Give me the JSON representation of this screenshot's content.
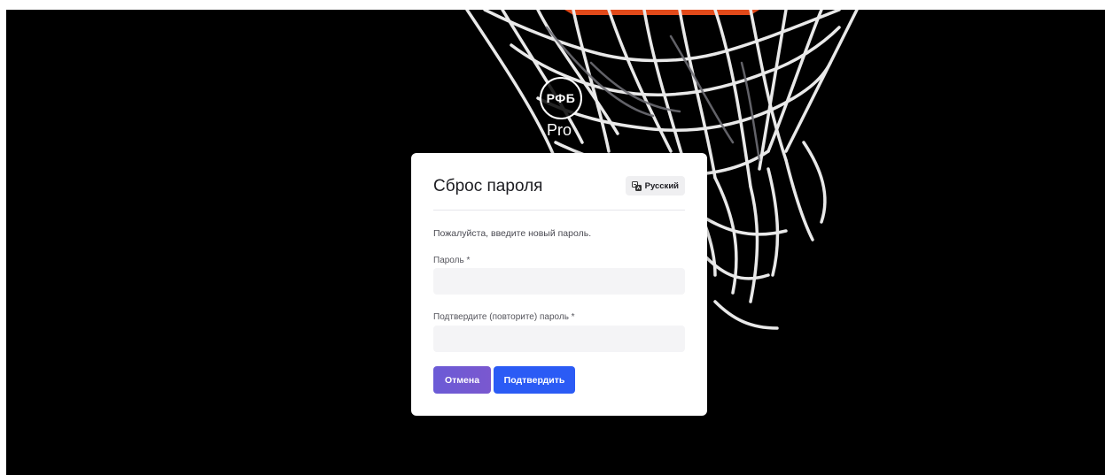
{
  "brand": {
    "logo_text": "РФБ",
    "sub_text": "Pro"
  },
  "form": {
    "title": "Сброс пароля",
    "language_label": "Русский",
    "instructions": "Пожалуйста, введите новый пароль.",
    "password_label": "Пароль *",
    "password_value": "",
    "password_placeholder": "",
    "confirm_label": "Подтвердите (повторите) пароль *",
    "confirm_value": "",
    "confirm_placeholder": "",
    "cancel_label": "Отмена",
    "submit_label": "Подтвердить"
  },
  "colors": {
    "background": "#000000",
    "cancel_button": "#6e56cf",
    "submit_button": "#2b5bf5",
    "input_background": "#f4f4f6"
  },
  "icons": {
    "language": "translate-icon",
    "background_art": "basketball-net-icon"
  }
}
